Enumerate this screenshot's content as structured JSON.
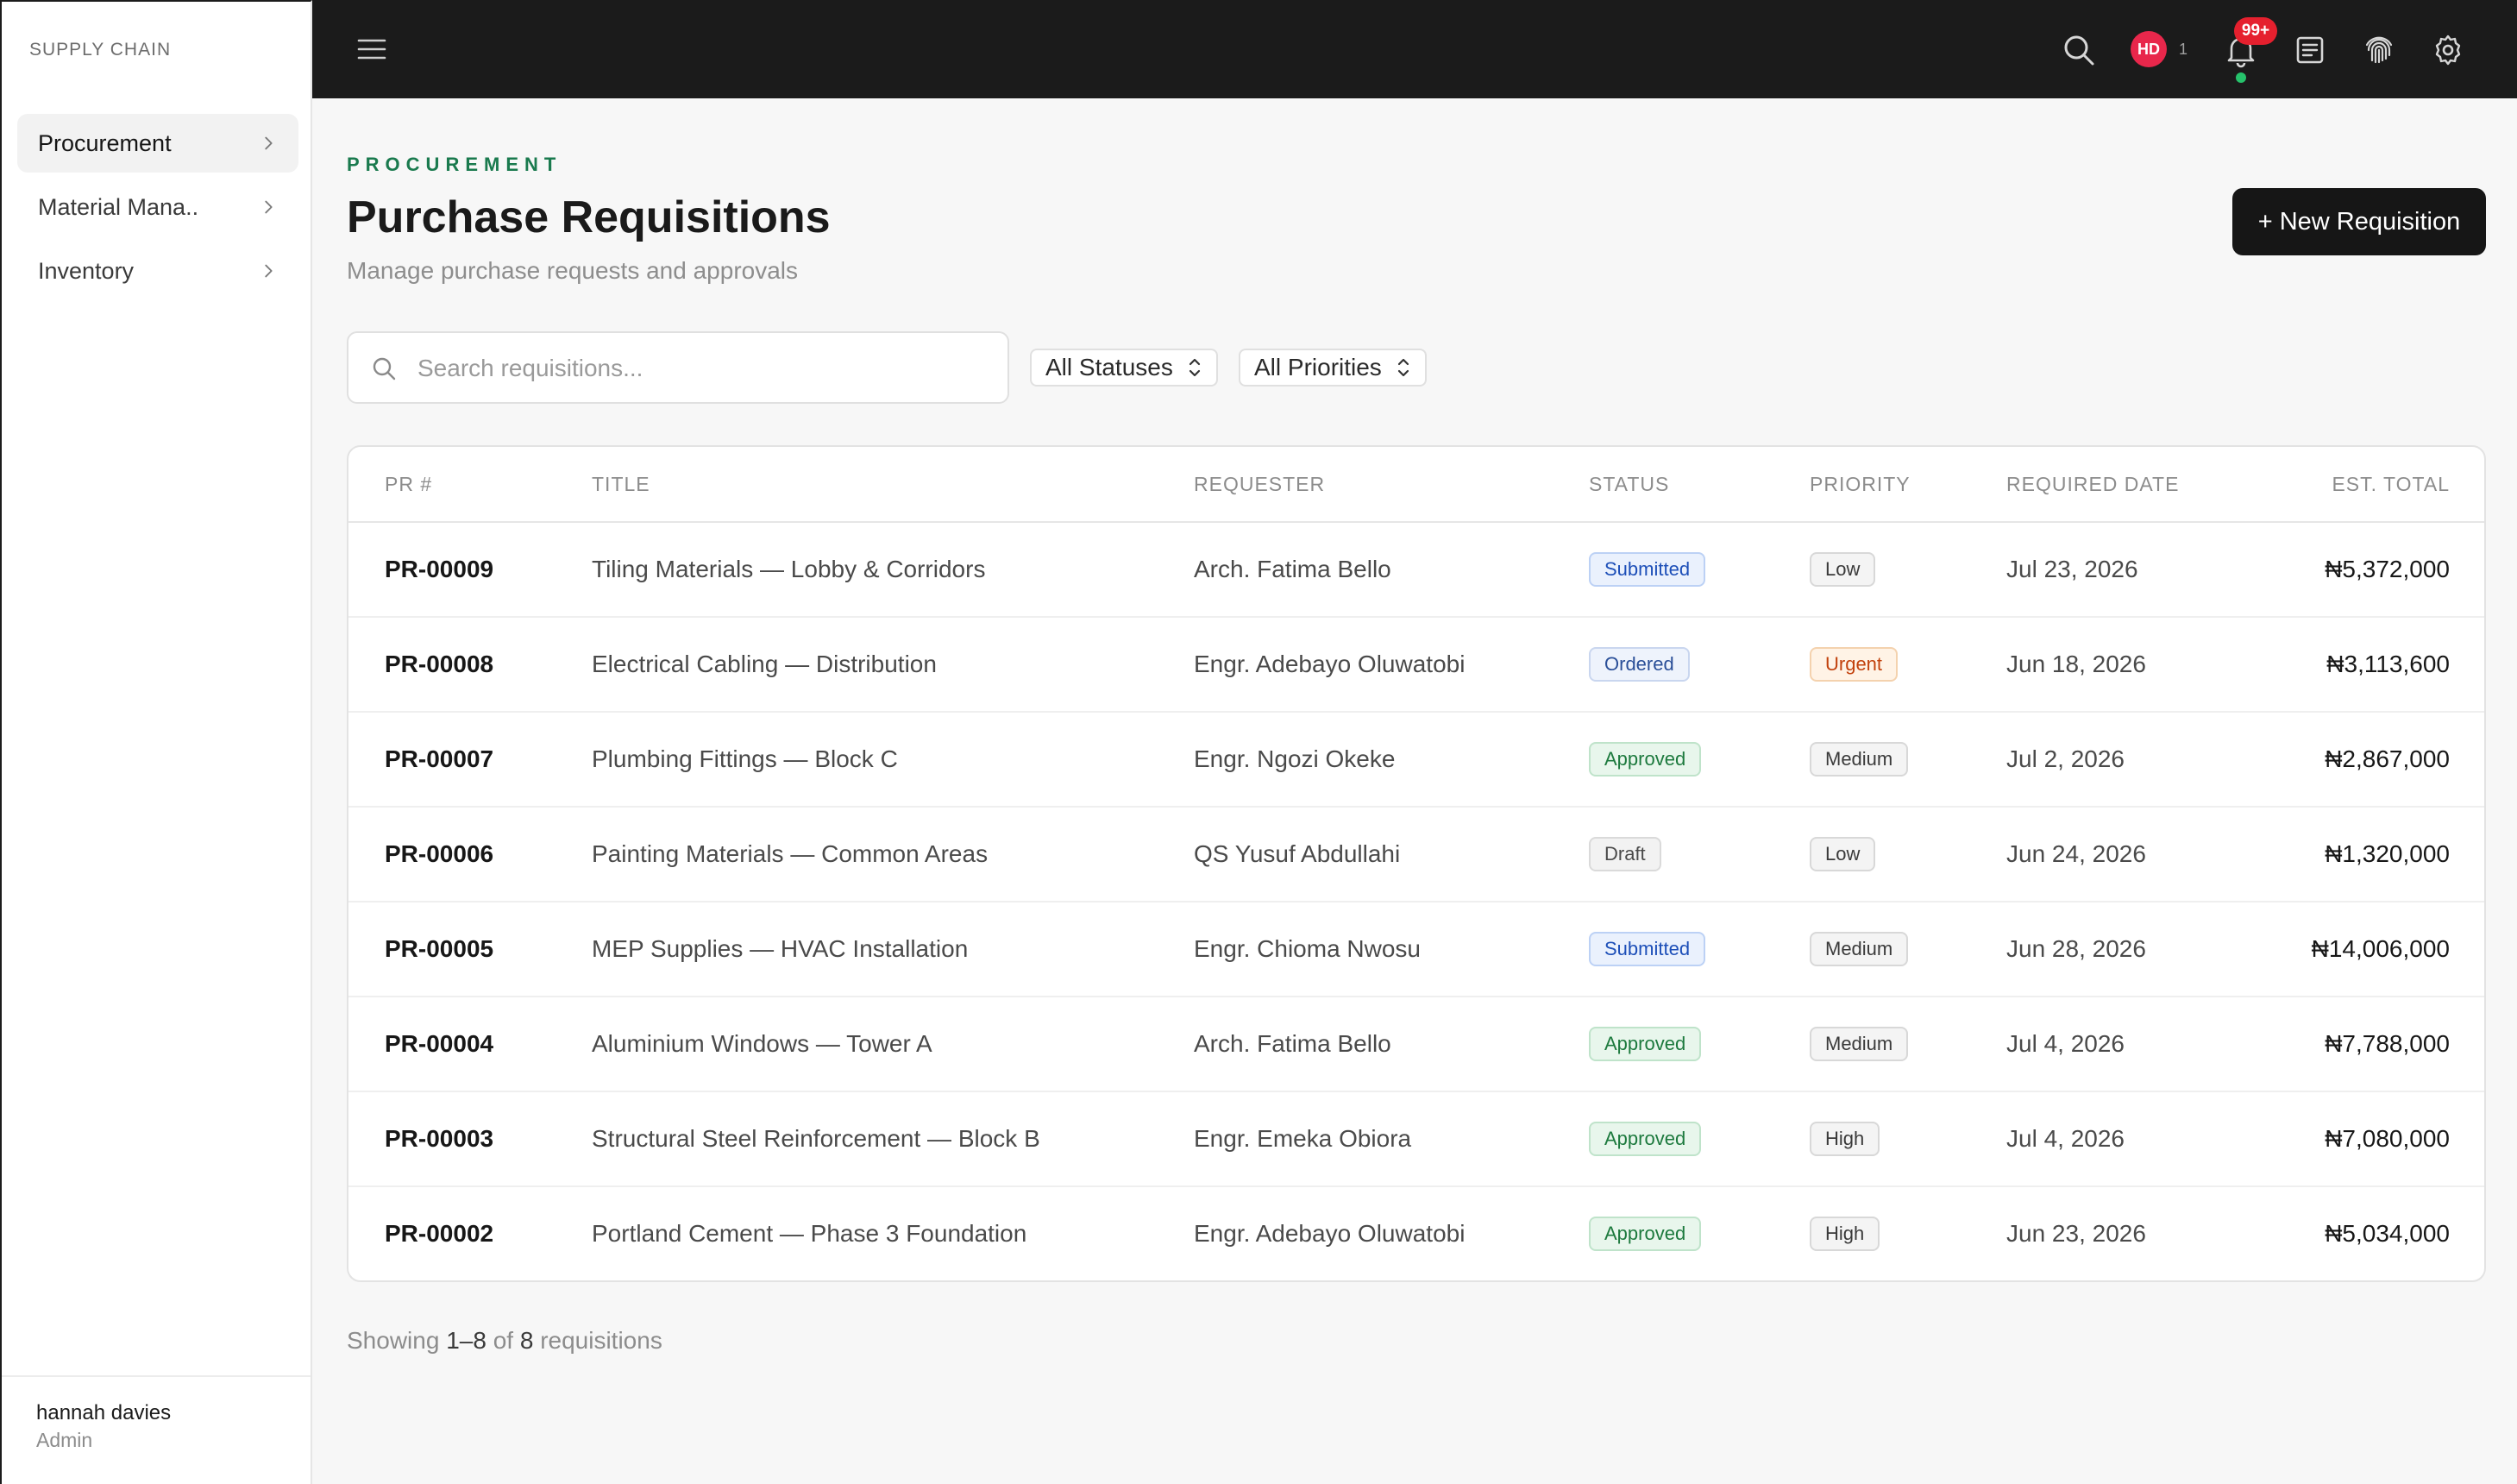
{
  "sidebar": {
    "brand": "SUPPLY CHAIN",
    "items": [
      {
        "label": "Procurement",
        "active": true
      },
      {
        "label": "Material Mana..",
        "active": false
      },
      {
        "label": "Inventory",
        "active": false
      }
    ],
    "user": {
      "name": "hannah davies",
      "role": "Admin"
    }
  },
  "topbar": {
    "avatar_initials": "HD",
    "avatar_count": "1",
    "notifications_badge": "99+",
    "icons": [
      "menu-icon",
      "search-icon",
      "bell-icon",
      "document-icon",
      "fingerprint-icon",
      "gear-icon"
    ]
  },
  "header": {
    "eyebrow": "PROCUREMENT",
    "title": "Purchase Requisitions",
    "subtitle": "Manage purchase requests and approvals",
    "new_button": "+ New Requisition"
  },
  "filters": {
    "search_placeholder": "Search requisitions...",
    "status": "All Statuses",
    "priority": "All Priorities"
  },
  "table": {
    "columns": [
      "PR #",
      "TITLE",
      "REQUESTER",
      "STATUS",
      "PRIORITY",
      "REQUIRED DATE",
      "EST. TOTAL"
    ],
    "rows": [
      {
        "pr": "PR-00009",
        "title": "Tiling Materials — Lobby & Corridors",
        "requester": "Arch. Fatima Bello",
        "status": "Submitted",
        "priority": "Low",
        "date": "Jul 23, 2026",
        "total": "₦5,372,000"
      },
      {
        "pr": "PR-00008",
        "title": "Electrical Cabling — Distribution",
        "requester": "Engr. Adebayo Oluwatobi",
        "status": "Ordered",
        "priority": "Urgent",
        "date": "Jun 18, 2026",
        "total": "₦3,113,600"
      },
      {
        "pr": "PR-00007",
        "title": "Plumbing Fittings — Block C",
        "requester": "Engr. Ngozi Okeke",
        "status": "Approved",
        "priority": "Medium",
        "date": "Jul 2, 2026",
        "total": "₦2,867,000"
      },
      {
        "pr": "PR-00006",
        "title": "Painting Materials — Common Areas",
        "requester": "QS Yusuf Abdullahi",
        "status": "Draft",
        "priority": "Low",
        "date": "Jun 24, 2026",
        "total": "₦1,320,000"
      },
      {
        "pr": "PR-00005",
        "title": "MEP Supplies — HVAC Installation",
        "requester": "Engr. Chioma Nwosu",
        "status": "Submitted",
        "priority": "Medium",
        "date": "Jun 28, 2026",
        "total": "₦14,006,000"
      },
      {
        "pr": "PR-00004",
        "title": "Aluminium Windows — Tower A",
        "requester": "Arch. Fatima Bello",
        "status": "Approved",
        "priority": "Medium",
        "date": "Jul 4, 2026",
        "total": "₦7,788,000"
      },
      {
        "pr": "PR-00003",
        "title": "Structural Steel Reinforcement — Block B",
        "requester": "Engr. Emeka Obiora",
        "status": "Approved",
        "priority": "High",
        "date": "Jul 4, 2026",
        "total": "₦7,080,000"
      },
      {
        "pr": "PR-00002",
        "title": "Portland Cement — Phase 3 Foundation",
        "requester": "Engr. Adebayo Oluwatobi",
        "status": "Approved",
        "priority": "High",
        "date": "Jun 23, 2026",
        "total": "₦5,034,000"
      }
    ]
  },
  "footer": {
    "prefix": "Showing",
    "range": "1–8",
    "of": "of",
    "count": "8",
    "suffix": "requisitions"
  },
  "colors": {
    "topbar": "#1b1b1b",
    "accent_green": "#1a7a4e",
    "status_submitted": "#1d4fb8",
    "status_approved": "#1d7a3e",
    "priority_urgent": "#c2410c",
    "badge_red": "#e5202e"
  }
}
